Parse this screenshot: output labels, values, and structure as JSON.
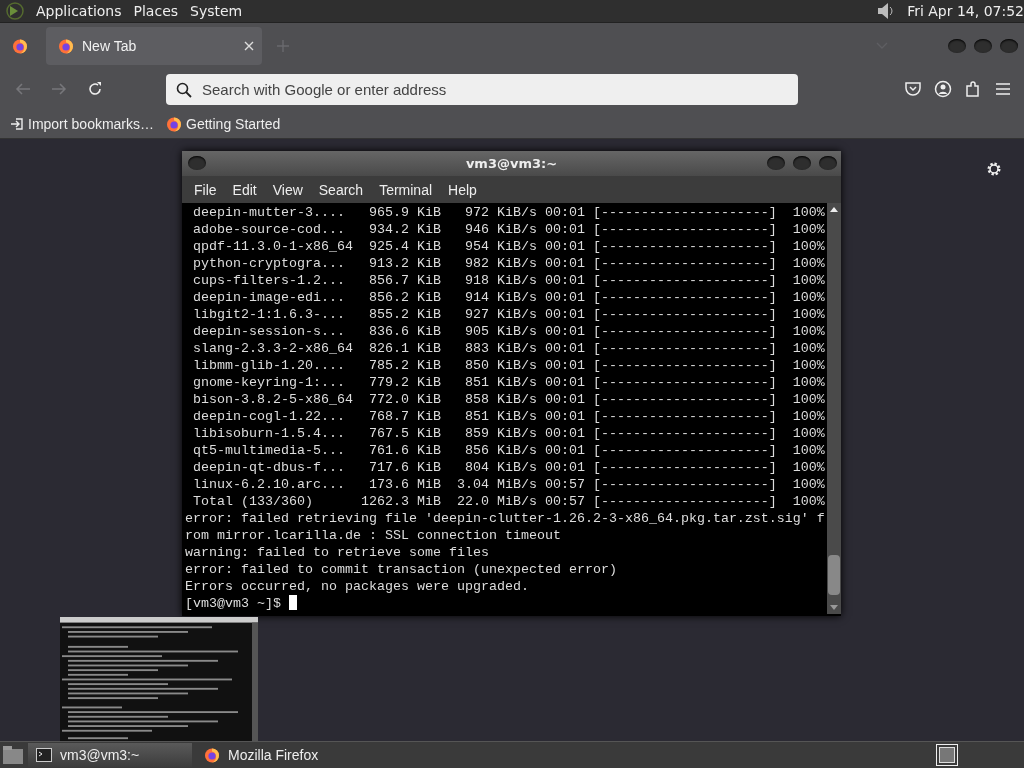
{
  "top_panel": {
    "menus": [
      "Applications",
      "Places",
      "System"
    ],
    "clock": "Fri Apr 14, 07:52"
  },
  "browser": {
    "tabs": [
      {
        "label": "New Tab",
        "selected": true
      }
    ],
    "toolbar": {
      "back_disabled": true,
      "forward_disabled": true
    },
    "address_bar": {
      "placeholder": "Search with Google or enter address"
    },
    "bookmarks": [
      {
        "kind": "import",
        "label": "Import bookmarks…"
      },
      {
        "kind": "firefox",
        "label": "Getting Started"
      }
    ]
  },
  "terminal": {
    "title": "vm3@vm3:~",
    "menus": [
      "File",
      "Edit",
      "View",
      "Search",
      "Terminal",
      "Help"
    ],
    "downloads": [
      {
        "name": "deepin-mutter-3....",
        "size": "965.9 KiB",
        "speed": "972 KiB/s",
        "time": "00:01",
        "bar": "[---------------------]",
        "percent": "100%"
      },
      {
        "name": "adobe-source-cod...",
        "size": "934.2 KiB",
        "speed": "946 KiB/s",
        "time": "00:01",
        "bar": "[---------------------]",
        "percent": "100%"
      },
      {
        "name": "qpdf-11.3.0-1-x86_64",
        "size": "925.4 KiB",
        "speed": "954 KiB/s",
        "time": "00:01",
        "bar": "[---------------------]",
        "percent": "100%"
      },
      {
        "name": "python-cryptogra...",
        "size": "913.2 KiB",
        "speed": "982 KiB/s",
        "time": "00:01",
        "bar": "[---------------------]",
        "percent": "100%"
      },
      {
        "name": "cups-filters-1.2...",
        "size": "856.7 KiB",
        "speed": "918 KiB/s",
        "time": "00:01",
        "bar": "[---------------------]",
        "percent": "100%"
      },
      {
        "name": "deepin-image-edi...",
        "size": "856.2 KiB",
        "speed": "914 KiB/s",
        "time": "00:01",
        "bar": "[---------------------]",
        "percent": "100%"
      },
      {
        "name": "libgit2-1:1.6.3-...",
        "size": "855.2 KiB",
        "speed": "927 KiB/s",
        "time": "00:01",
        "bar": "[---------------------]",
        "percent": "100%"
      },
      {
        "name": "deepin-session-s...",
        "size": "836.6 KiB",
        "speed": "905 KiB/s",
        "time": "00:01",
        "bar": "[---------------------]",
        "percent": "100%"
      },
      {
        "name": "slang-2.3.3-2-x86_64",
        "size": "826.1 KiB",
        "speed": "883 KiB/s",
        "time": "00:01",
        "bar": "[---------------------]",
        "percent": "100%"
      },
      {
        "name": "libmm-glib-1.20....",
        "size": "785.2 KiB",
        "speed": "850 KiB/s",
        "time": "00:01",
        "bar": "[---------------------]",
        "percent": "100%"
      },
      {
        "name": "gnome-keyring-1:...",
        "size": "779.2 KiB",
        "speed": "851 KiB/s",
        "time": "00:01",
        "bar": "[---------------------]",
        "percent": "100%"
      },
      {
        "name": "bison-3.8.2-5-x86_64",
        "size": "772.0 KiB",
        "speed": "858 KiB/s",
        "time": "00:01",
        "bar": "[---------------------]",
        "percent": "100%"
      },
      {
        "name": "deepin-cogl-1.22...",
        "size": "768.7 KiB",
        "speed": "851 KiB/s",
        "time": "00:01",
        "bar": "[---------------------]",
        "percent": "100%"
      },
      {
        "name": "libisoburn-1.5.4...",
        "size": "767.5 KiB",
        "speed": "859 KiB/s",
        "time": "00:01",
        "bar": "[---------------------]",
        "percent": "100%"
      },
      {
        "name": "qt5-multimedia-5...",
        "size": "761.6 KiB",
        "speed": "856 KiB/s",
        "time": "00:01",
        "bar": "[---------------------]",
        "percent": "100%"
      },
      {
        "name": "deepin-qt-dbus-f...",
        "size": "717.6 KiB",
        "speed": "804 KiB/s",
        "time": "00:01",
        "bar": "[---------------------]",
        "percent": "100%"
      },
      {
        "name": "linux-6.2.10.arc...",
        "size": "173.6 MiB",
        "speed": "3.04 MiB/s",
        "time": "00:57",
        "bar": "[---------------------]",
        "percent": "100%"
      },
      {
        "name": "Total (133/360)",
        "size": "1262.3 MiB",
        "speed": "22.0 MiB/s",
        "time": "00:57",
        "bar": "[---------------------]",
        "percent": "100%"
      }
    ],
    "messages": [
      "error: failed retrieving file 'deepin-clutter-1.26.2-3-x86_64.pkg.tar.zst.sig' f",
      "rom mirror.lcarilla.de : SSL connection timeout",
      "warning: failed to retrieve some files",
      "error: failed to commit transaction (unexpected error)",
      "Errors occurred, no packages were upgraded."
    ],
    "prompt": "[vm3@vm3 ~]$"
  },
  "taskbar": {
    "tasks": [
      {
        "kind": "terminal",
        "label": "vm3@vm3:~",
        "selected": true
      },
      {
        "kind": "firefox",
        "label": "Mozilla Firefox",
        "selected": false
      }
    ]
  }
}
